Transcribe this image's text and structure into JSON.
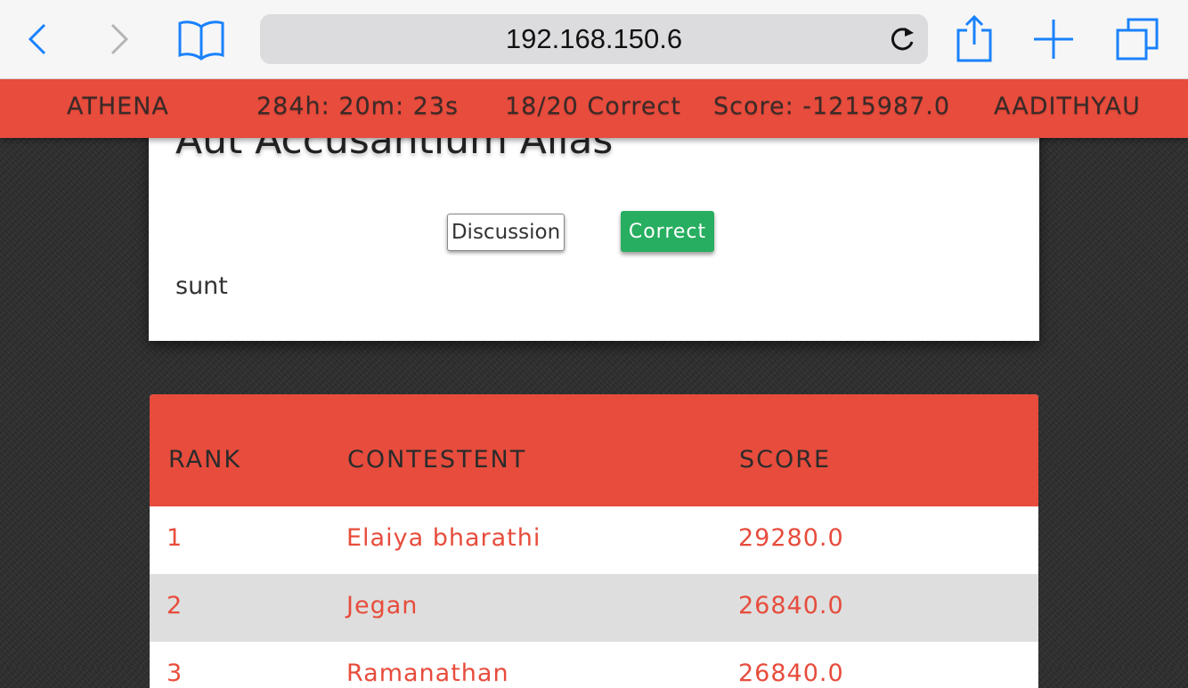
{
  "browser": {
    "url": "192.168.150.6",
    "icons": [
      "back-icon",
      "forward-icon",
      "bookmarks-icon",
      "reload-icon",
      "share-icon",
      "new-tab-icon",
      "tabs-icon"
    ]
  },
  "status_bar": {
    "app_name": "ATHENA",
    "timer": "284h: 20m: 23s",
    "progress": "18/20 Correct",
    "score": "Score: -1215987.0",
    "username": "AADITHYAU"
  },
  "question": {
    "title": "Aut Accusantium Alias",
    "discussion_label": "Discussion",
    "status_label": "Correct",
    "answer": "sunt"
  },
  "leaderboard": {
    "headers": {
      "rank": "RANK",
      "contestant": "CONTESTENT",
      "score": "SCORE"
    },
    "rows": [
      {
        "rank": "1",
        "name": "Elaiya bharathi",
        "score": "29280.0"
      },
      {
        "rank": "2",
        "name": "Jegan",
        "score": "26840.0"
      },
      {
        "rank": "3",
        "name": "Ramanathan",
        "score": "26840.0"
      }
    ]
  },
  "colors": {
    "accent": "#e74c3c",
    "success": "#27ae60",
    "ios_blue": "#1a82fb",
    "background": "#2e2e2e"
  }
}
